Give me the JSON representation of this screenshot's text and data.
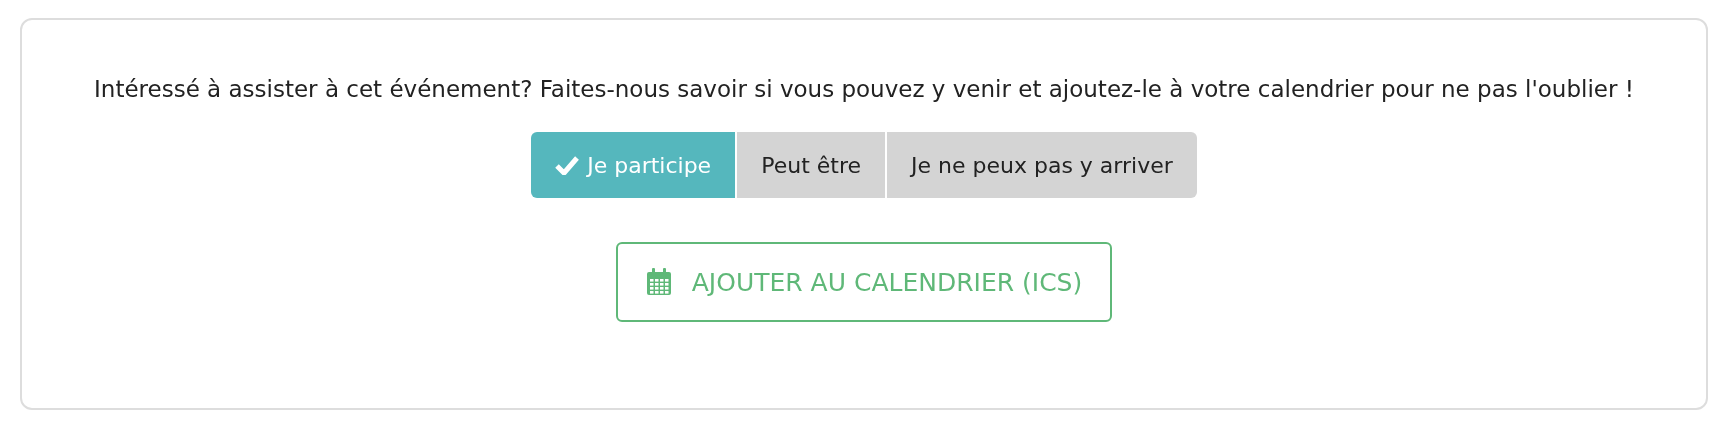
{
  "message": "Intéressé à assister à cet événement? Faites-nous savoir si vous pouvez y venir et ajoutez-le à votre calendrier pour ne pas l'oublier !",
  "rsvp_options": [
    {
      "label": "Je participe",
      "selected": true
    },
    {
      "label": "Peut être",
      "selected": false
    },
    {
      "label": "Je ne peux pas y arriver",
      "selected": false
    }
  ],
  "calendar_button": {
    "label": "AJOUTER AU CALENDRIER (ICS)"
  }
}
